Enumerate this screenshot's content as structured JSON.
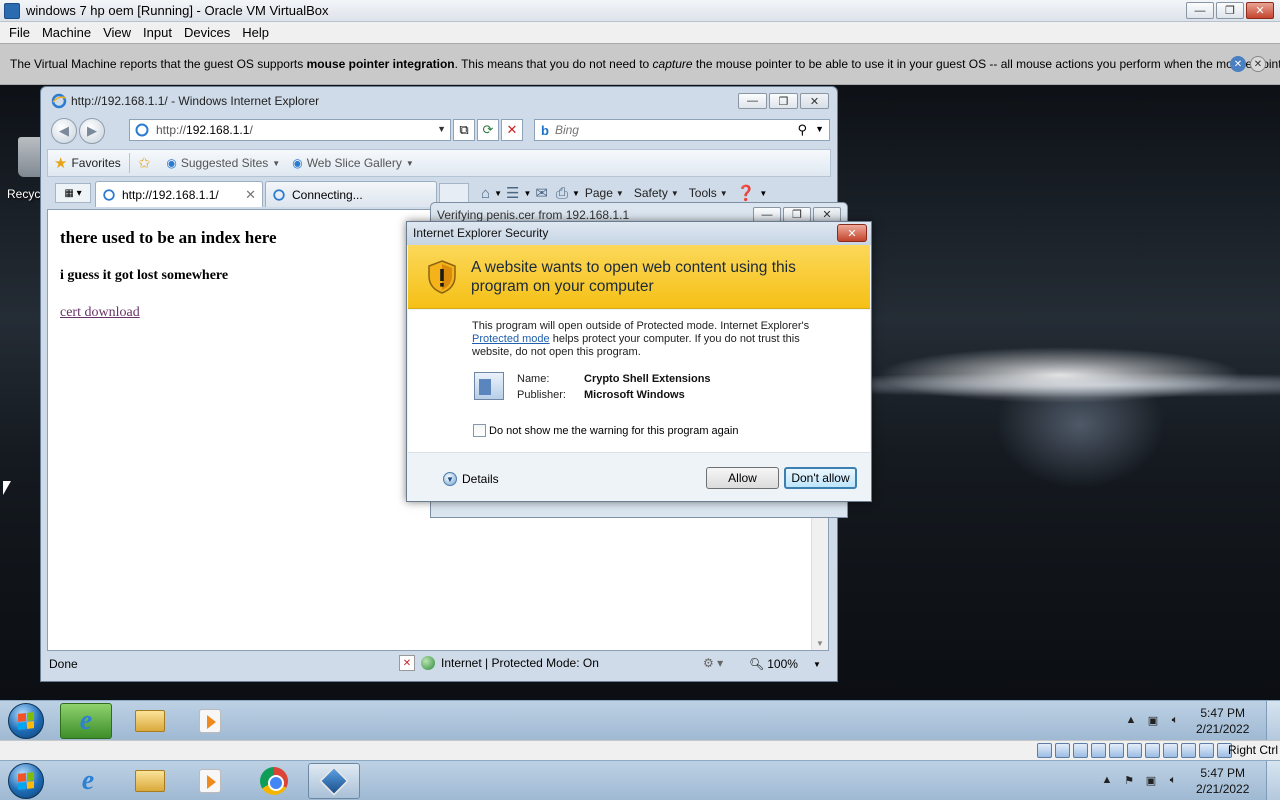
{
  "vbox": {
    "title": "windows 7 hp oem [Running] - Oracle VM VirtualBox",
    "menu": [
      "File",
      "Machine",
      "View",
      "Input",
      "Devices",
      "Help"
    ],
    "notice_prefix": "The Virtual Machine reports that the guest OS supports ",
    "notice_bold": "mouse pointer integration",
    "notice_middle": ". This means that you do not need to ",
    "notice_italic": "capture",
    "notice_suffix": " the mouse pointer to be able to use it in your guest OS -- all mouse actions you perform when the mouse pointer is over",
    "host_key_label": "Right Ctrl"
  },
  "desktop": {
    "recycle_label": "Recyc"
  },
  "ie": {
    "title": "http://192.168.1.1/ - Windows Internet Explorer",
    "address_prefix": "http://",
    "address_host": "192.168.1.1",
    "address_suffix": "/",
    "search_placeholder": "Bing",
    "favorites_label": "Favorites",
    "suggested_sites_label": "Suggested Sites",
    "web_slice_label": "Web Slice Gallery",
    "tabs": [
      {
        "label": "http://192.168.1.1/",
        "active": true
      },
      {
        "label": "Connecting...",
        "active": false
      }
    ],
    "commands": {
      "page": "Page",
      "safety": "Safety",
      "tools": "Tools"
    },
    "content": {
      "heading": "there used to be an index here",
      "subheading": "i guess it got lost somewhere",
      "link": "cert download"
    },
    "status": {
      "done": "Done",
      "zone": "Internet | Protected Mode: On",
      "zoom": "100%"
    }
  },
  "verify_window": {
    "title": "Verifying penis.cer from 192.168.1.1"
  },
  "security_dialog": {
    "title": "Internet Explorer Security",
    "heading": "A website wants to open web content using this program on your computer",
    "desc_before": "This program will open outside of Protected mode. Internet Explorer's ",
    "desc_link": "Protected mode",
    "desc_after": " helps protect your computer. If you do not trust this website, do not open this program.",
    "name_label": "Name:",
    "name_value": "Crypto Shell Extensions",
    "publisher_label": "Publisher:",
    "publisher_value": "Microsoft Windows",
    "checkbox_label": "Do not show me the warning for this program again",
    "details_label": "Details",
    "allow_label": "Allow",
    "deny_label": "Don't allow"
  },
  "guest_taskbar": {
    "time": "5:47 PM",
    "date": "2/21/2022"
  },
  "host_taskbar": {
    "time": "5:47 PM",
    "date": "2/21/2022"
  }
}
